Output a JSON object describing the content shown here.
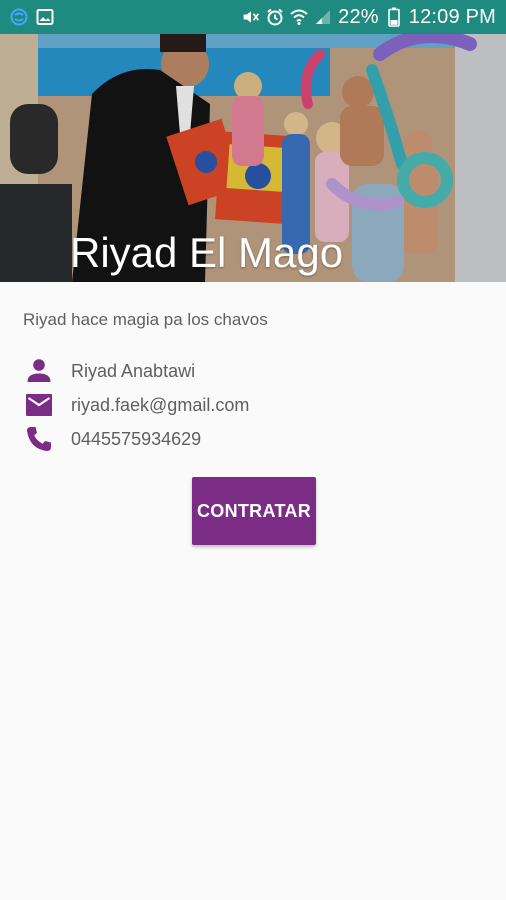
{
  "status_bar": {
    "battery": "22%",
    "time": "12:09 PM",
    "color": "#1f8a7f",
    "left_icons": [
      "sync-icon",
      "image-icon"
    ],
    "right_icons": [
      "mute-icon",
      "alarm-icon",
      "wifi-icon",
      "signal-icon",
      "battery-icon"
    ]
  },
  "header": {
    "title": "Riyad El Mago"
  },
  "profile": {
    "description": "Riyad hace magia pa los chavos",
    "name": "Riyad Anabtawi",
    "email": "riyad.faek@gmail.com",
    "phone": "0445575934629",
    "icons": [
      "person-icon",
      "email-icon",
      "phone-icon"
    ],
    "accent_color": "#7b2d85"
  },
  "actions": {
    "hire_label": "CONTRATAR"
  }
}
